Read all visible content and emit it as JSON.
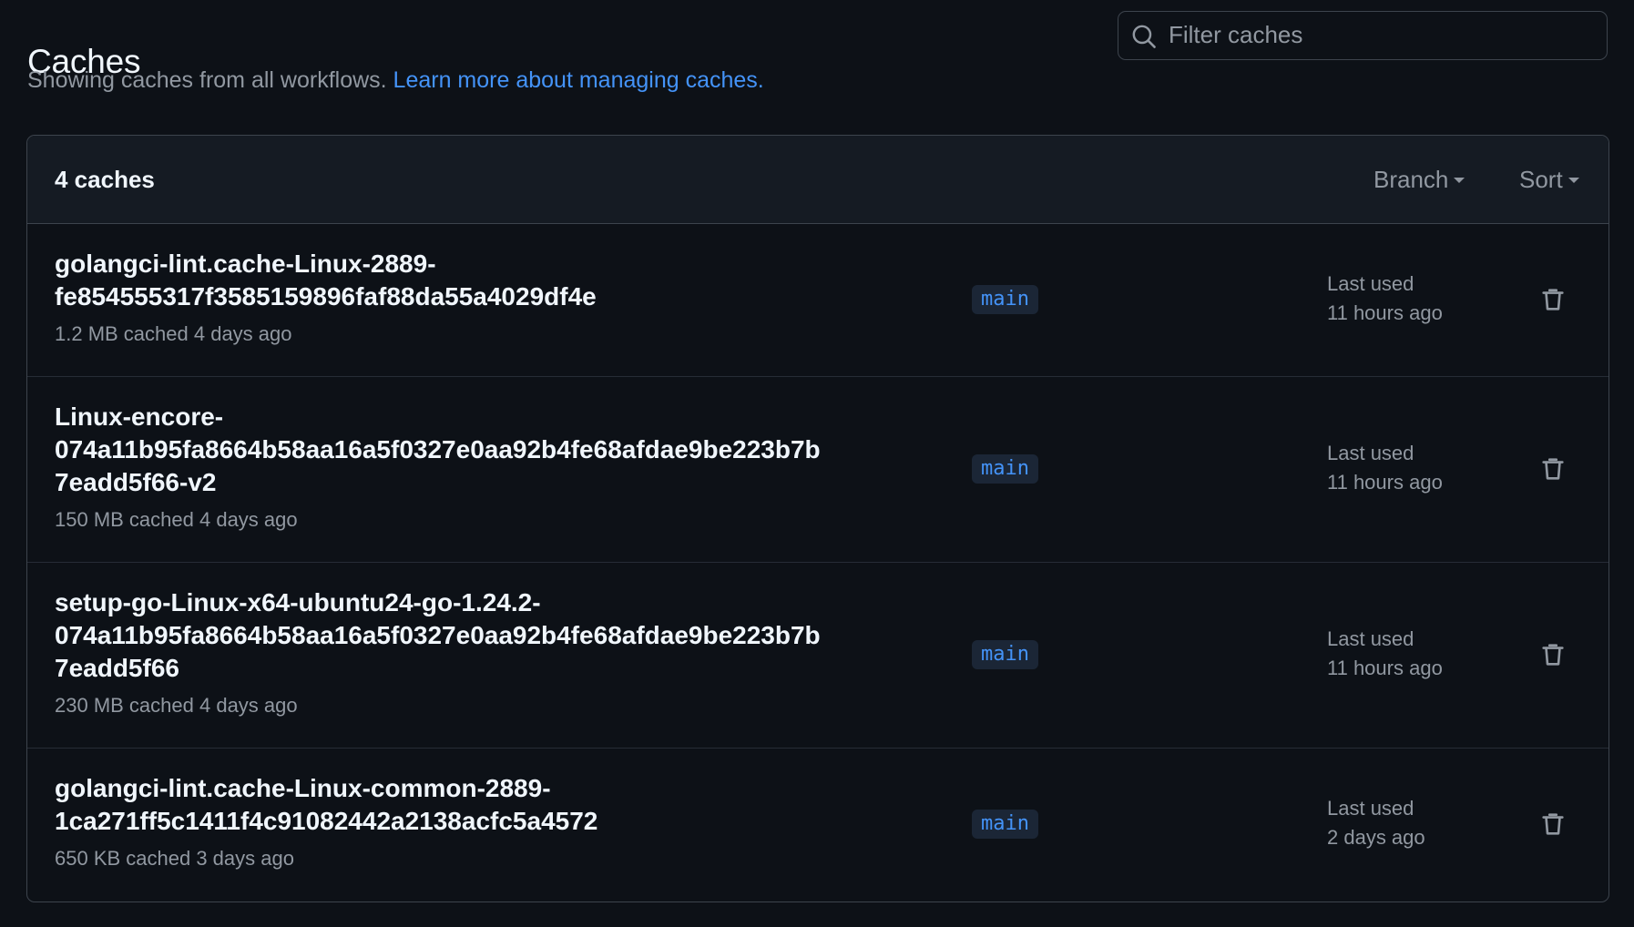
{
  "header": {
    "title": "Caches",
    "subtitle_text": "Showing caches from all workflows.",
    "subtitle_link": "Learn more about managing caches."
  },
  "filter": {
    "placeholder": "Filter caches",
    "value": "",
    "icon": "search-icon"
  },
  "panel": {
    "count_label": "4 caches",
    "branch_filter_label": "Branch",
    "sort_label": "Sort"
  },
  "caches": [
    {
      "name_lines": [
        "golangci-lint.cache-Linux-2889-",
        "fe854555317f3585159896faf88da55a4029df4e"
      ],
      "meta": "1.2 MB cached 4 days ago",
      "branch": "main",
      "last_used_label": "Last used",
      "last_used_value": "11 hours ago"
    },
    {
      "name_lines": [
        "Linux-encore-",
        "074a11b95fa8664b58aa16a5f0327e0aa92b4fe68afdae9be223b7b",
        "7eadd5f66-v2"
      ],
      "meta": "150 MB cached 4 days ago",
      "branch": "main",
      "last_used_label": "Last used",
      "last_used_value": "11 hours ago"
    },
    {
      "name_lines": [
        "setup-go-Linux-x64-ubuntu24-go-1.24.2-",
        "074a11b95fa8664b58aa16a5f0327e0aa92b4fe68afdae9be223b7b",
        "7eadd5f66"
      ],
      "meta": "230 MB cached 4 days ago",
      "branch": "main",
      "last_used_label": "Last used",
      "last_used_value": "11 hours ago"
    },
    {
      "name_lines": [
        "golangci-lint.cache-Linux-common-2889-",
        "1ca271ff5c1411f4c91082442a2138acfc5a4572"
      ],
      "meta": "650 KB cached 3 days ago",
      "branch": "main",
      "last_used_label": "Last used",
      "last_used_value": "2 days ago"
    }
  ]
}
